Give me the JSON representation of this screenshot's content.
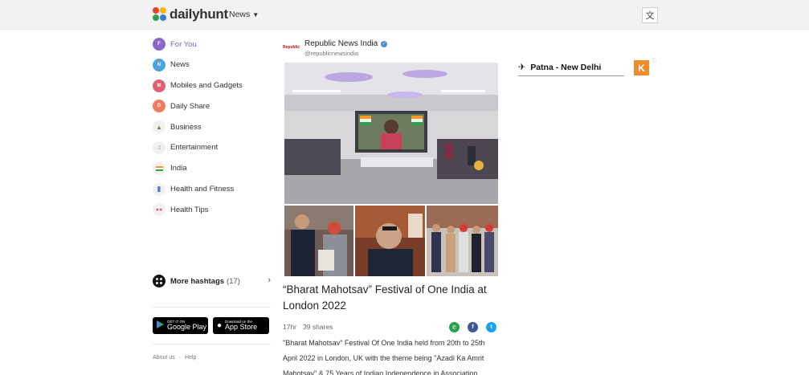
{
  "header": {
    "logo_text": "dailyhunt",
    "news_menu_label": "News",
    "language_icon": "translate-icon"
  },
  "sidebar": {
    "items": [
      {
        "label": "For You",
        "icon": "for-you-icon",
        "color": "#8a67c9"
      },
      {
        "label": "News",
        "icon": "news-icon",
        "color": "#4aa3df"
      },
      {
        "label": "Mobiles and Gadgets",
        "icon": "mobiles-icon",
        "color": "#e06070"
      },
      {
        "label": "Daily Share",
        "icon": "daily-share-icon",
        "color": "#ef7d5c"
      },
      {
        "label": "Business",
        "icon": "business-icon",
        "color": "#f1f1f1"
      },
      {
        "label": "Entertainment",
        "icon": "entertainment-icon",
        "color": "#f1f1f1"
      },
      {
        "label": "India",
        "icon": "india-flag-icon",
        "color": "#f1f1f1"
      },
      {
        "label": "Health and Fitness",
        "icon": "health-fitness-icon",
        "color": "#f1f1f1"
      },
      {
        "label": "Health Tips",
        "icon": "health-tips-icon",
        "color": "#f1f1f1"
      }
    ],
    "hashtags_label": "More hashtags",
    "hashtags_count": "(17)"
  },
  "stores": {
    "google_small": "GET IT ON",
    "google_big": "Google Play",
    "apple_small": "Download on the",
    "apple_big": "App Store"
  },
  "footer": {
    "about": "About us",
    "help": "Help"
  },
  "article": {
    "source_logo": "Republic",
    "source_name": "Republic News India",
    "source_handle": "@republicnewsindia",
    "title": "“Bharat Mahotsav” Festival of One India at London 2022",
    "time": "17hr",
    "shares": "39 shares",
    "body": "\"Bharat Mahotsav\" Festival Of One India held from 20th to 25th April 2022 in London, UK with the theme being \"Azadi Ka Amrit Mahotsav\" & 75 Years of Indian Independence in Association"
  },
  "right": {
    "flight_route": "Patna - New Delhi",
    "ad_letter": "K"
  },
  "colors": {
    "accent": "#7a5cc0",
    "whatsapp": "#25a244",
    "facebook": "#3b5998",
    "twitter": "#1da1f2",
    "ad": "#f28c28"
  }
}
